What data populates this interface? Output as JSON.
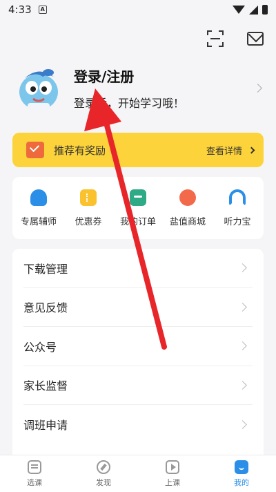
{
  "status_bar": {
    "time": "4:33",
    "a_badge": "A"
  },
  "header": {
    "scan_icon": "scan-icon",
    "mail_icon": "mail-icon"
  },
  "profile": {
    "title": "登录/注册",
    "subtitle": "登录后，开始学习哦！"
  },
  "banner": {
    "text": "推荐有奖励",
    "link": "查看详情",
    "color": "#fcd33a"
  },
  "shortcuts": [
    {
      "label": "专属辅师",
      "icon": "tutor-icon"
    },
    {
      "label": "优惠券",
      "icon": "coupon-icon"
    },
    {
      "label": "我的订单",
      "icon": "order-icon"
    },
    {
      "label": "盐值商城",
      "icon": "mall-icon"
    },
    {
      "label": "听力宝",
      "icon": "headphones-icon"
    }
  ],
  "menu": [
    {
      "label": "下载管理"
    },
    {
      "label": "意见反馈"
    },
    {
      "label": "公众号"
    },
    {
      "label": "家长监督"
    },
    {
      "label": "调班申请"
    }
  ],
  "tabs": [
    {
      "label": "选课",
      "active": false
    },
    {
      "label": "发现",
      "active": false
    },
    {
      "label": "上课",
      "active": false
    },
    {
      "label": "我的",
      "active": true
    }
  ],
  "colors": {
    "accent": "#2b8fe8",
    "annotation_arrow": "#e8262a"
  }
}
